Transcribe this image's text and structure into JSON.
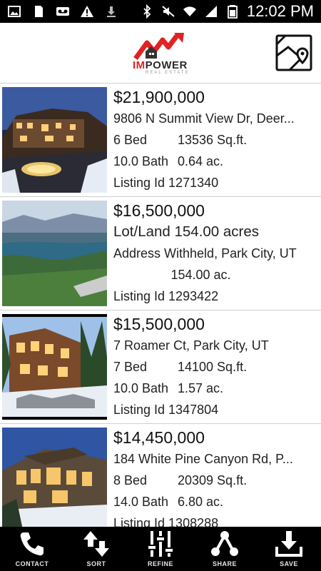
{
  "status_bar": {
    "time": "12:02 PM"
  },
  "brand": {
    "logo_im": "IM",
    "logo_power": "POWER",
    "logo_sub": "REAL ESTATE"
  },
  "listings": [
    {
      "price": "$21,900,000",
      "address": "9806 N Summit View Dr, Deer...",
      "beds": "6 Bed",
      "sqft": "13536 Sq.ft.",
      "baths": "10.0 Bath",
      "acres": "0.64 ac.",
      "listing_id": "Listing Id 1271340"
    },
    {
      "price": "$16,500,000",
      "type": "Lot/Land 154.00 acres",
      "address": "Address Withheld,  Park City, UT",
      "acres": "154.00 ac.",
      "listing_id": "Listing Id 1293422"
    },
    {
      "price": "$15,500,000",
      "address": "7 Roamer Ct,  Park City, UT",
      "beds": "7 Bed",
      "sqft": "14100 Sq.ft.",
      "baths": "10.0 Bath",
      "acres": "1.57 ac.",
      "listing_id": "Listing Id 1347804"
    },
    {
      "price": "$14,450,000",
      "address": "184 White Pine Canyon Rd,  P...",
      "beds": "8 Bed",
      "sqft": "20309 Sq.ft.",
      "baths": "14.0 Bath",
      "acres": "6.80 ac.",
      "listing_id": "Listing Id 1308288"
    }
  ],
  "bottom_nav": [
    {
      "label": "CONTACT",
      "icon": "phone-icon"
    },
    {
      "label": "SORT",
      "icon": "sort-arrows-icon"
    },
    {
      "label": "REFINE",
      "icon": "sliders-icon"
    },
    {
      "label": "SHARE",
      "icon": "share-icon"
    },
    {
      "label": "SAVE",
      "icon": "download-icon"
    }
  ]
}
